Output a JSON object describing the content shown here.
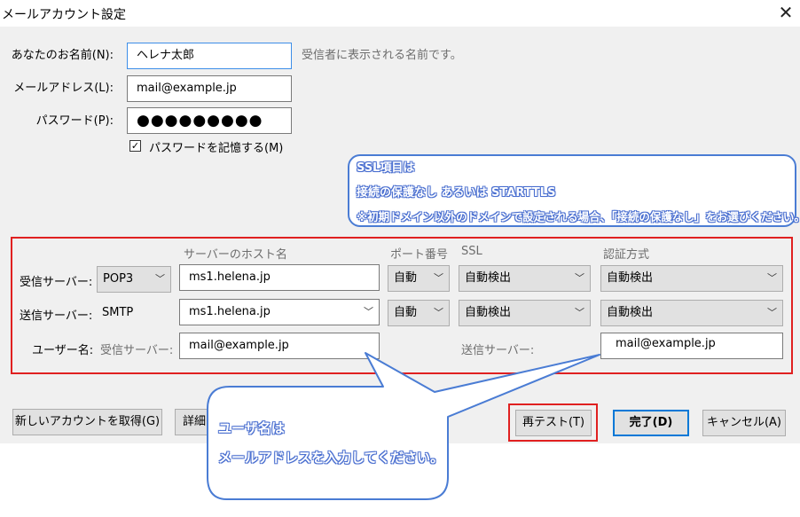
{
  "window": {
    "title": "メールアカウント設定",
    "close_glyph": "✕"
  },
  "account": {
    "name_label": "あなたのお名前(N):",
    "name_value": "ヘレナ太郎",
    "name_hint": "受信者に表示される名前です。",
    "email_label": "メールアドレス(L):",
    "email_value": "mail@example.jp",
    "password_label": "パスワード(P):",
    "password_value": "●●●●●●●●●",
    "remember_label": "パスワードを記憶する(M)",
    "remember_checked": true,
    "check_glyph": "✓"
  },
  "server": {
    "headers": {
      "host": "サーバーのホスト名",
      "port": "ポート番号",
      "ssl": "SSL",
      "auth": "認証方式"
    },
    "incoming": {
      "label": "受信サーバー:",
      "protocol": "POP3",
      "host": "ms1.helena.jp",
      "port": "自動",
      "ssl": "自動検出",
      "auth": "自動検出"
    },
    "outgoing": {
      "label": "送信サーバー:",
      "protocol": "SMTP",
      "host": "ms1.helena.jp",
      "port": "自動",
      "ssl": "自動検出",
      "auth": "自動検出"
    },
    "username": {
      "label": "ユーザー名:",
      "incoming_label": "受信サーバー:",
      "incoming_value": "mail@example.jp",
      "outgoing_label": "送信サーバー:",
      "outgoing_value": "mail@example.jp"
    }
  },
  "buttons": {
    "new_account": "新しいアカウントを取得(G)",
    "advanced": "詳細",
    "retest": "再テスト(T)",
    "done": "完了(D)",
    "cancel": "キャンセル(A)"
  },
  "annotations": {
    "ssl_note": {
      "line1": "SSL項目は",
      "line2": "接続の保護なし あるいは STARTTLS",
      "line3": "※初期ドメイン以外のドメインで設定される場合、「接続の保護なし」をお選びください。"
    },
    "username_note": {
      "line1": "ユーザ名は",
      "line2": "メールアドレスを入力してください。"
    },
    "colors": {
      "highlight_border": "#e02020",
      "callout_border": "#4a7cd4",
      "callout_text_outline": "#4a6fd0"
    }
  },
  "icons": {
    "dropdown": "chevron-down-icon",
    "close": "close-icon",
    "checkbox": "checkmark-icon"
  }
}
